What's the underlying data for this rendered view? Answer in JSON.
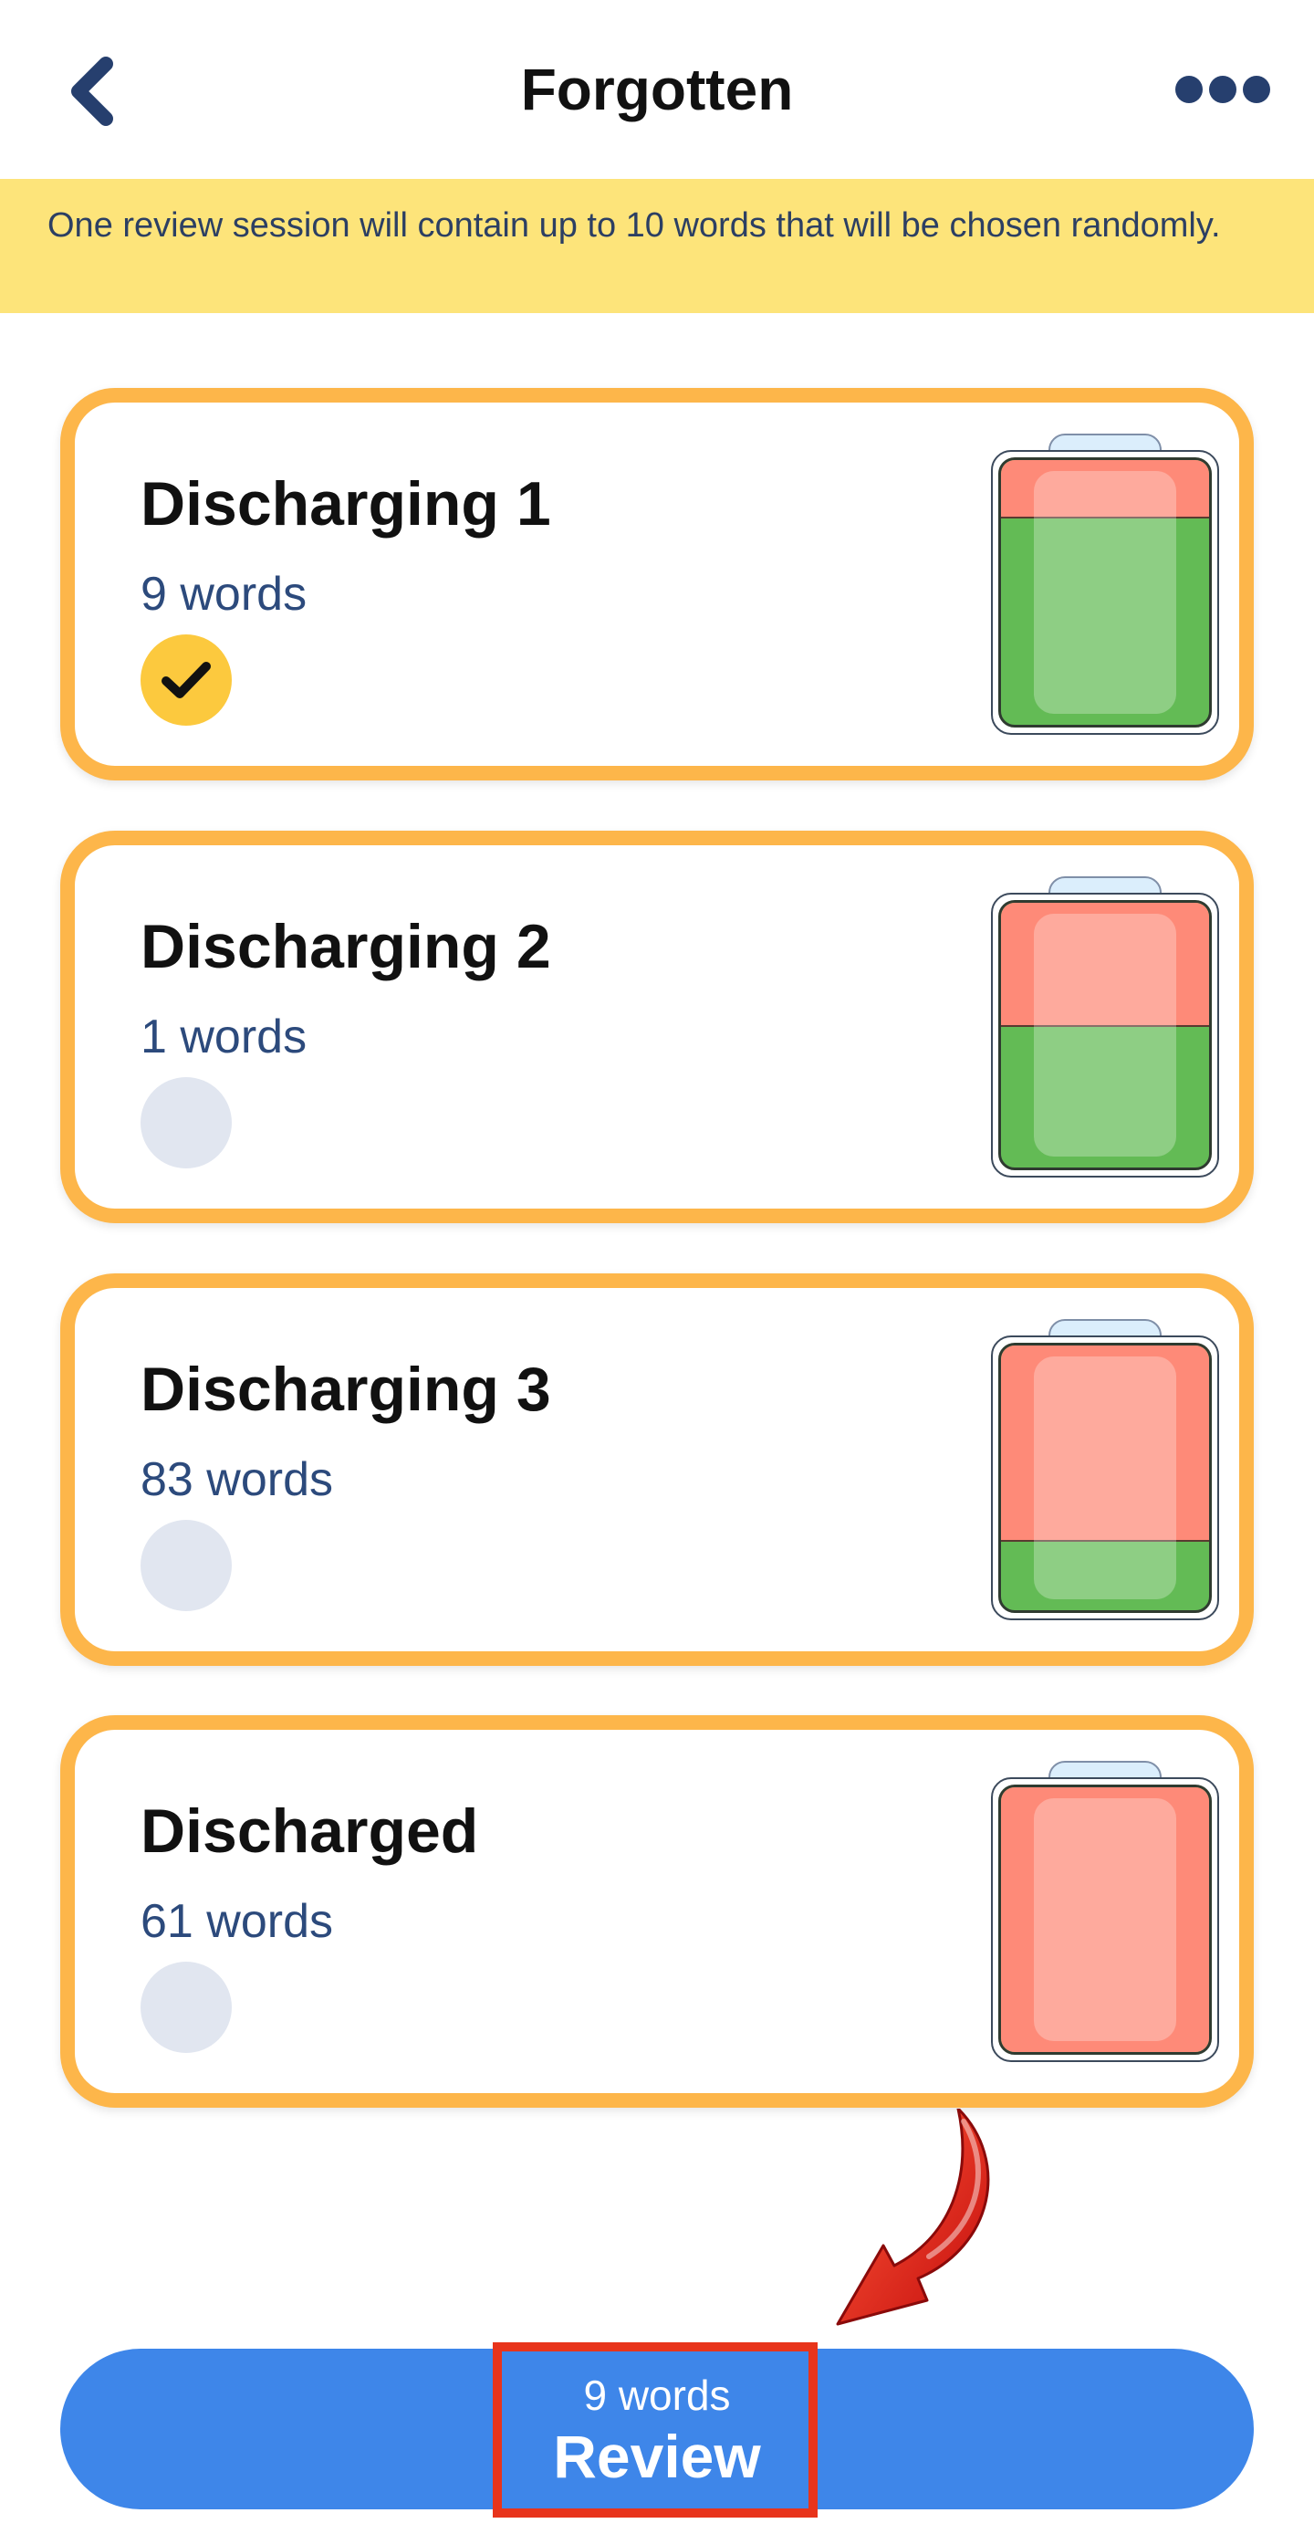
{
  "header": {
    "title": "Forgotten",
    "back_icon": "chevron-left-icon",
    "more_icon": "more-horizontal-icon"
  },
  "notice": {
    "text": "One review session will contain up to 10 words that will be chosen randomly."
  },
  "levels": [
    {
      "title": "Discharging 1",
      "count": "9 words",
      "selected": true,
      "charge_fraction": 0.78
    },
    {
      "title": "Discharging 2",
      "count": "1 words",
      "selected": false,
      "charge_fraction": 0.53
    },
    {
      "title": "Discharging 3",
      "count": "83 words",
      "selected": false,
      "charge_fraction": 0.26
    },
    {
      "title": "Discharged",
      "count": "61 words",
      "selected": false,
      "charge_fraction": 0.0
    }
  ],
  "review": {
    "count": "9 words",
    "label": "Review"
  },
  "colors": {
    "accent_blue": "#3e86e9",
    "card_border": "#fdb64a",
    "notice_bg": "#fde47a",
    "battery_green": "#63bb55",
    "battery_red": "#fe8a78",
    "check_selected": "#fcc93e",
    "highlight_red": "#e8341b"
  }
}
